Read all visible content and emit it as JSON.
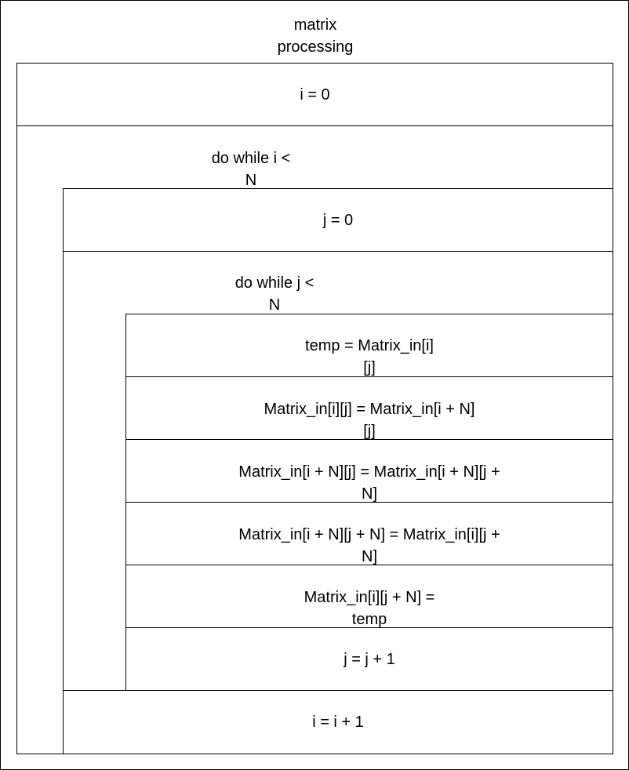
{
  "diagram": {
    "title_line1": "matrix",
    "title_line2": "processing",
    "steps": {
      "init_i": "i = 0",
      "loop_i_line1": "do while i <",
      "loop_i_line2": "N",
      "init_j": "j = 0",
      "loop_j_line1": "do while j <",
      "loop_j_line2": "N",
      "temp_line1": "temp = Matrix_in[i]",
      "temp_line2": "[j]",
      "assign1_line1": "Matrix_in[i][j] = Matrix_in[i + N]",
      "assign1_line2": "[j]",
      "assign2_line1": "Matrix_in[i + N][j] = Matrix_in[i + N][j +",
      "assign2_line2": "N]",
      "assign3_line1": "Matrix_in[i + N][j + N] = Matrix_in[i][j +",
      "assign3_line2": "N]",
      "assign4_line1": "Matrix_in[i][j + N] =",
      "assign4_line2": "temp",
      "inc_j": "j = j + 1",
      "inc_i": "i = i + 1"
    }
  }
}
